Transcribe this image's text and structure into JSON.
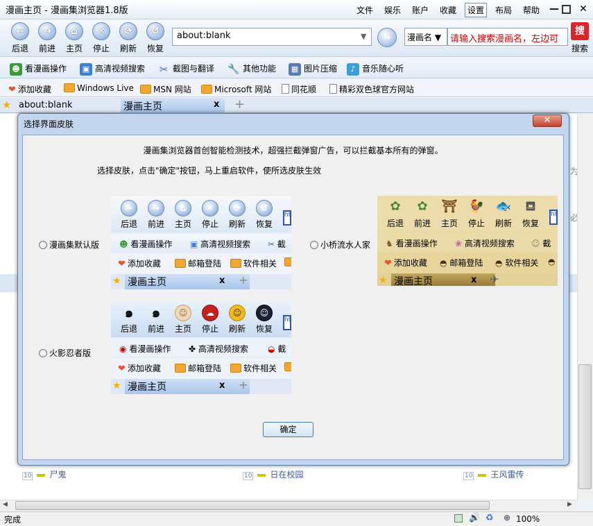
{
  "app": {
    "title": "漫画主页 - 漫画集浏览器1.8版"
  },
  "menu": {
    "items": [
      "文件",
      "娱乐",
      "账户",
      "收藏",
      "设置",
      "布局",
      "帮助"
    ],
    "active": "设置"
  },
  "nav": {
    "back": "后退",
    "forward": "前进",
    "home": "主页",
    "stop": "停止",
    "refresh": "刷新",
    "restore": "恢复"
  },
  "address": {
    "value": "about:blank"
  },
  "search": {
    "engine": "漫画名",
    "placeholder": "请输入搜索漫画名，左边可",
    "button": "搜索",
    "button_icon_text": "搜"
  },
  "toolbar": {
    "items": [
      "看漫画操作",
      "高清视频搜索",
      "截图与翻译",
      "其他功能",
      "图片压缩",
      "音乐随心听"
    ]
  },
  "favorites": {
    "items": [
      "添加收藏",
      "Windows Live",
      "MSN 网站",
      "Microsoft 网站",
      "同花顺",
      "精彩双色球官方网站"
    ]
  },
  "tabs": [
    {
      "label": "about:blank"
    },
    {
      "label": "漫画主页",
      "close": "x"
    }
  ],
  "tab_add": "+",
  "background_rows": [
    {
      "num": "10",
      "name": "尸鬼"
    },
    {
      "num": "10",
      "name": "日在校园"
    },
    {
      "num": "10",
      "name": "王风雷传"
    }
  ],
  "background_fragments": {
    "right1": "为",
    "right2": "必"
  },
  "status": {
    "text": "完成",
    "zoom": "100%"
  },
  "dialog": {
    "title": "选择界面皮肤",
    "intro": "漫画集浏览器首创智能检测技术，超强拦截弹窗广告，可以拦截基本所有的弹窗。",
    "hint": "选择皮肤，点击\"确定\"按钮，马上重启软件，使所选皮肤生效",
    "skins": [
      {
        "label": "漫画集默认版"
      },
      {
        "label": "小桥流水人家"
      },
      {
        "label": "火影忍者版"
      }
    ],
    "ok": "确定"
  },
  "preview": {
    "nav": [
      "后退",
      "前进",
      "主页",
      "停止",
      "刷新",
      "恢复"
    ],
    "nav_icons": [
      "←",
      "→",
      "⌂",
      "✕",
      "⟳",
      "↺"
    ],
    "tool": [
      "看漫画操作",
      "高清视频搜索",
      "截"
    ],
    "fav_default": [
      "添加收藏",
      "邮箱登陆",
      "软件相关"
    ],
    "tab_home": "漫画主页",
    "tab_close": "x",
    "tab_add": "+",
    "addr_fragment": "ht"
  }
}
